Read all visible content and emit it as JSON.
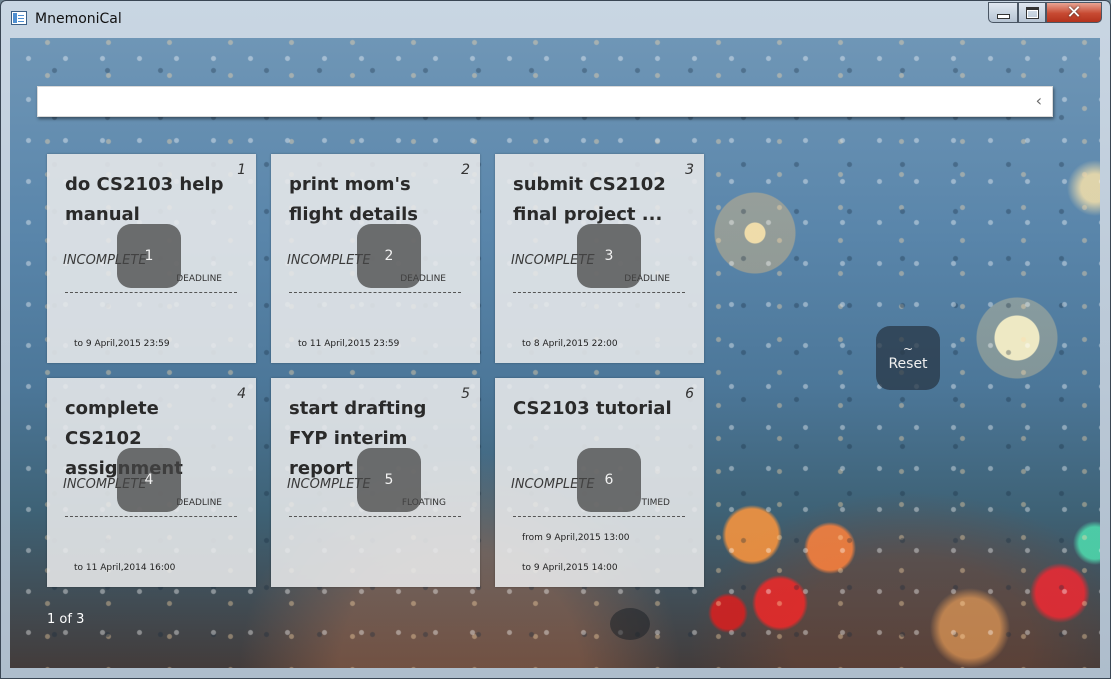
{
  "window": {
    "title": "MnemoniCal",
    "close_glyph": "✕"
  },
  "command_bar": {
    "value": "",
    "placeholder": "",
    "collapse_glyph": "‹"
  },
  "cards": [
    {
      "index": "1",
      "title": "do CS2103 help manual",
      "status": "INCOMPLETE",
      "type": "DEADLINE",
      "from": "",
      "date": "to 9 April,2015 23:59",
      "handle": "1"
    },
    {
      "index": "2",
      "title": "print mom's flight details",
      "status": "INCOMPLETE",
      "type": "DEADLINE",
      "from": "",
      "date": "to 11 April,2015 23:59",
      "handle": "2"
    },
    {
      "index": "3",
      "title": "submit CS2102 final project ...",
      "status": "INCOMPLETE",
      "type": "DEADLINE",
      "from": "",
      "date": "to 8 April,2015 22:00",
      "handle": "3"
    },
    {
      "index": "4",
      "title": "complete CS2102 assignment",
      "status": "INCOMPLETE",
      "type": "DEADLINE",
      "from": "",
      "date": "to 11 April,2014 16:00",
      "handle": "4"
    },
    {
      "index": "5",
      "title": "start drafting FYP interim report",
      "status": "INCOMPLETE",
      "type": "FLOATING",
      "from": "",
      "date": "",
      "handle": "5"
    },
    {
      "index": "6",
      "title": "CS2103 tutorial",
      "status": "INCOMPLETE",
      "type": "TIMED",
      "from": "from 9 April,2015 13:00",
      "date": "to 9 April,2015 14:00",
      "handle": "6"
    }
  ],
  "reset": {
    "tilde": "~",
    "label": "Reset"
  },
  "pagination": {
    "text": "1 of 3"
  }
}
